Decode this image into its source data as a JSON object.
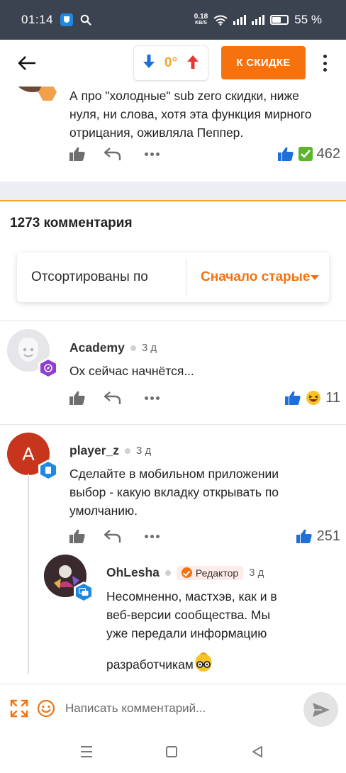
{
  "status_bar": {
    "time": "01:14",
    "net_speed": "0.18",
    "net_unit": "KB/S",
    "battery": "55 %",
    "battery_level": 0.55
  },
  "header": {
    "temperature": "0°",
    "deal_button": "К СКИДКЕ"
  },
  "top_comment": {
    "text_line1": "А про \"холодные\" sub zero скидки, ниже",
    "text_line2": "нуля, ни слова, хотя эта функция мирного",
    "text_line3": "отрицания, оживляла Пеппер.",
    "likes": "462"
  },
  "comments_header": "1273 комментария",
  "sort": {
    "label": "Отсортированы по",
    "value": "Сначало старые"
  },
  "comments": [
    {
      "author": "Academy",
      "time": "3 д",
      "text_line1": "Ох сейчас начнётся...",
      "likes": "11"
    },
    {
      "author": "player_z",
      "avatar_letter": "A",
      "time": "3 д",
      "text_line1": "Сделайте в мобильном приложении",
      "text_line2": "выбор - какую вкладку открывать по",
      "text_line3": "умолчанию.",
      "likes": "251"
    },
    {
      "author": "OhLesha",
      "badge": "Редактор",
      "time": "3 д",
      "text_line1": "Несомненно, мастхэв, как и в",
      "text_line2": "веб-версии сообщества. Мы",
      "text_line3": "уже передали информацию",
      "text_line4": "разработчикам"
    }
  ],
  "composer": {
    "placeholder": "Написать комментарий..."
  },
  "colors": {
    "accent": "#f5720f",
    "temperature": "#f5a623",
    "status_bar": "#3c4350"
  }
}
